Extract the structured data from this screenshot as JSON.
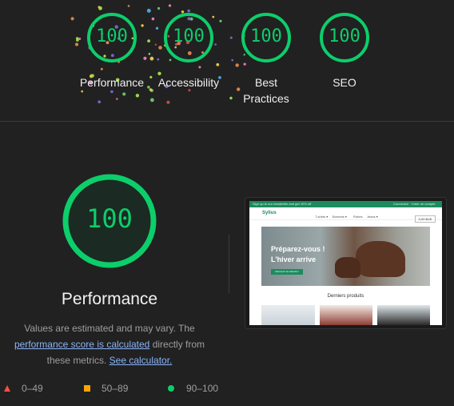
{
  "categories": [
    {
      "score": "100",
      "label": "Performance"
    },
    {
      "score": "100",
      "label": "Accessibility"
    },
    {
      "score": "100",
      "label": "Best Practices"
    },
    {
      "score": "100",
      "label": "SEO"
    }
  ],
  "performance": {
    "score": "100",
    "title": "Performance",
    "desc_before": "Values are estimated and may vary. The ",
    "link_score": "performance score is calculated",
    "desc_middle": " directly from these metrics. ",
    "link_calc": "See calculator."
  },
  "legend": [
    {
      "range": "0–49",
      "shape": "triangle",
      "color": "#ff4e42"
    },
    {
      "range": "50–89",
      "shape": "square",
      "color": "#ffa400"
    },
    {
      "range": "90–100",
      "shape": "circle",
      "color": "#0cce6b"
    }
  ],
  "colors": {
    "pass": "#0cce6b",
    "background": "#212121",
    "link": "#8ab4f8"
  },
  "screenshot": {
    "topbar_left": "Sign up to our newsletter and get 10% off",
    "topbar_right": "Connexion · Créer un compte",
    "logo": "Sylius",
    "nav": [
      "T-shirts ▾",
      "Bonnets ▾",
      "Robes",
      "Jeans ▾"
    ],
    "cart": "0,00 $US",
    "hero_line1": "Préparez-vous !",
    "hero_line2": "L'hiver arrive",
    "hero_button": "Découvrir la collection",
    "section_title": "Derniers produits"
  }
}
